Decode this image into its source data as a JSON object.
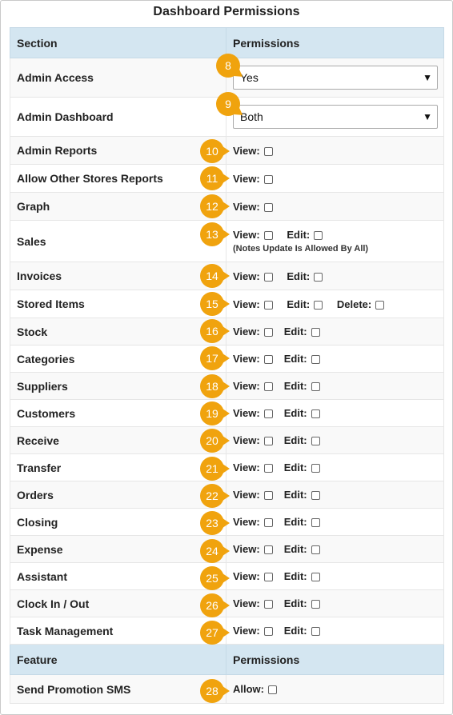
{
  "title": "Dashboard Permissions",
  "header": {
    "section": "Section",
    "permissions": "Permissions"
  },
  "labels": {
    "view": "View:",
    "edit": "Edit:",
    "delete": "Delete:",
    "allow": "Allow:"
  },
  "admin_access": {
    "label": "Admin Access",
    "value": "Yes",
    "badge": "8"
  },
  "admin_dashboard": {
    "label": "Admin Dashboard",
    "value": "Both",
    "badge": "9"
  },
  "rows": [
    {
      "label": "Admin Reports",
      "badge": "10"
    },
    {
      "label": "Allow Other Stores Reports",
      "badge": "11"
    },
    {
      "label": "Graph",
      "badge": "12"
    },
    {
      "label": "Sales",
      "badge": "13",
      "note": "(Notes Update Is Allowed By All)"
    },
    {
      "label": "Invoices",
      "badge": "14"
    },
    {
      "label": "Stored Items",
      "badge": "15"
    },
    {
      "label": "Stock",
      "badge": "16"
    },
    {
      "label": "Categories",
      "badge": "17"
    },
    {
      "label": "Suppliers",
      "badge": "18"
    },
    {
      "label": "Customers",
      "badge": "19"
    },
    {
      "label": "Receive",
      "badge": "20"
    },
    {
      "label": "Transfer",
      "badge": "21"
    },
    {
      "label": "Orders",
      "badge": "22"
    },
    {
      "label": "Closing",
      "badge": "23"
    },
    {
      "label": "Expense",
      "badge": "24"
    },
    {
      "label": "Assistant",
      "badge": "25"
    },
    {
      "label": "Clock In / Out",
      "badge": "26"
    },
    {
      "label": "Task Management",
      "badge": "27"
    }
  ],
  "feature_header": {
    "feature": "Feature",
    "permissions": "Permissions"
  },
  "feature": {
    "label": "Send Promotion SMS",
    "badge": "28"
  },
  "colors": {
    "header_bg": "#d4e6f1",
    "badge": "#f0a30e",
    "alt_row": "#f9f9f9"
  }
}
